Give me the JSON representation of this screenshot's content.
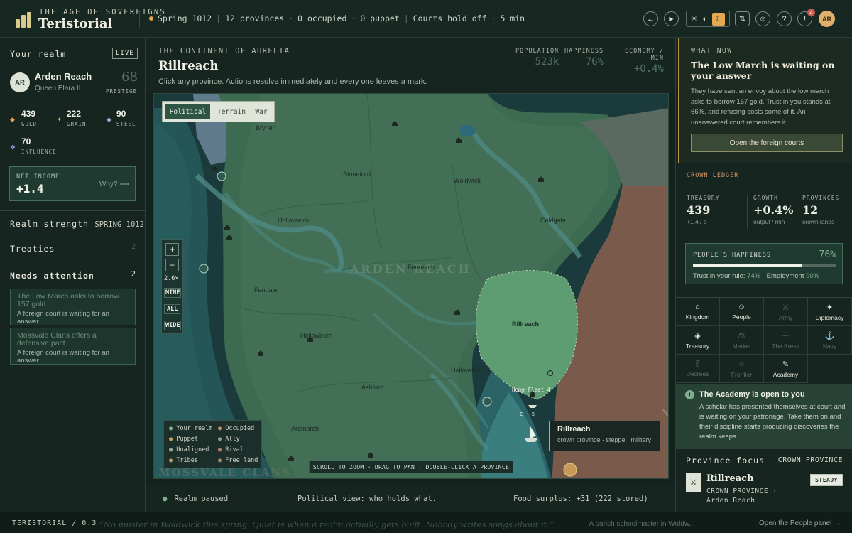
{
  "brand": {
    "subtitle": "THE AGE OF SOVEREIGNS",
    "name": "Teristorial"
  },
  "status": {
    "season": "Spring 1012",
    "provinces": "12 provinces",
    "occupied": "0 occupied",
    "puppet": "0 puppet",
    "courts": "Courts hold off",
    "time": "5 min"
  },
  "topbar": {
    "back": "←",
    "play": "▶",
    "theme_icons": [
      "☀",
      "◐",
      "☾"
    ],
    "sort": "⇅",
    "smile": "☺",
    "help": "?",
    "alert": "!",
    "alert_count": "4",
    "avatar": "AR"
  },
  "realm": {
    "section_title": "Your realm",
    "live": "LIVE",
    "avatar": "AR",
    "name": "Arden Reach",
    "ruler": "Queen Elara II",
    "prestige_value": "68",
    "prestige_label": "PRESTIGE",
    "resources": [
      {
        "value": "439",
        "label": "GOLD",
        "icon": "◆",
        "color": "#e0a54b"
      },
      {
        "value": "222",
        "label": "GRAIN",
        "icon": "✦",
        "color": "#c6c06a"
      },
      {
        "value": "90",
        "label": "STEEL",
        "icon": "◆",
        "color": "#8db0c9"
      },
      {
        "value": "70",
        "label": "INFLUENCE",
        "icon": "❖",
        "color": "#8f9fe0"
      }
    ],
    "net_income_label": "NET INCOME",
    "net_income": "+1.4",
    "why": "Why? ⟶",
    "strength_label": "Realm strength",
    "strength_season": "SPRING 1012",
    "treaties_label": "Treaties",
    "treaties_count": "2",
    "attention_label": "Needs attention",
    "attention_count": "2",
    "attention": [
      {
        "title": "The Low March asks to borrow 157 gold",
        "sub": "A foreign court is waiting for an answer."
      },
      {
        "title": "Mossvale Clans offers a defensive pact",
        "sub": "A foreign court is waiting for an answer."
      }
    ]
  },
  "center": {
    "continent": "THE CONTINENT OF AURELIA",
    "province": "Rillreach",
    "instruction": "Click any province. Actions resolve immediately and every one leaves a mark.",
    "stats": [
      {
        "label": "POPULATION",
        "value": "523k"
      },
      {
        "label": "HAPPINESS",
        "value": "76%"
      },
      {
        "label": "ECONOMY / MIN",
        "value": "+0.4%"
      }
    ],
    "map_tabs": [
      "Political",
      "Terrain",
      "War"
    ],
    "zoom": {
      "plus": "+",
      "minus": "−",
      "level": "2.6×",
      "mine": "MINE",
      "all": "ALL",
      "wide": "WIDE"
    },
    "realm_label": "ARDEN REACH",
    "region_label": "MOSSVALE CLANS",
    "edge_letter": "N",
    "towns": [
      "Brynen",
      "Stoneford",
      "Woldwick",
      "Hollowwick",
      "Caldgate",
      "Fenreach",
      "Fendale",
      "Rillreach",
      "Hollowburn",
      "Hollowdale",
      "Ashfurn",
      "Ardmarch"
    ],
    "fleet": "Home Fleet 4",
    "fleet_small": "C···5",
    "legend": [
      {
        "label": "Your realm",
        "color": "#7fae8e"
      },
      {
        "label": "Occupied",
        "color": "#c4876a"
      },
      {
        "label": "Puppet",
        "color": "#c6a25c"
      },
      {
        "label": "Ally",
        "color": "#8aa08a"
      },
      {
        "label": "Unaligned",
        "color": "#9aa89e"
      },
      {
        "label": "Rival",
        "color": "#b07a6a"
      },
      {
        "label": "Tribes",
        "color": "#b79a6a"
      },
      {
        "label": "Free land",
        "color": "#9c8a70"
      }
    ],
    "hint": "SCROLL TO ZOOM · DRAG TO PAN · DOUBLE-CLICK A PROVINCE",
    "tooltip_title": "Rillreach",
    "tooltip_sub": "crown province · steppe · military",
    "bottom": {
      "paused": "Realm paused",
      "view": "Political view: who holds what.",
      "food": "Food surplus: +31 (222 stored)"
    }
  },
  "right": {
    "what_now_label": "WHAT NOW",
    "what_now_title": "The Low March is waiting on your answer",
    "what_now_body": "They have sent an envoy about the low march asks to borrow 157 gold. Trust in you stands at 66%, and refusing costs some of it. An unanswered court remembers it.",
    "foreign_btn": "Open the foreign courts",
    "ledger_label": "CROWN LEDGER",
    "ledger": [
      {
        "label": "TREASURY",
        "value": "439",
        "sub": "+1.4 / s"
      },
      {
        "label": "GROWTH",
        "value": "+0.4%",
        "sub": "output / min"
      },
      {
        "label": "PROVINCES",
        "value": "12",
        "sub": "crown lands"
      }
    ],
    "happiness_label": "PEOPLE'S HAPPINESS",
    "happiness_value": "76%",
    "happiness_fraction": 0.76,
    "trust_text": "Trust in your rule:",
    "trust_value": "74%",
    "employment_text": "· Employment",
    "employment_value": "90%",
    "tabs": [
      {
        "label": "Kingdom",
        "icon": "⌂",
        "lit": true
      },
      {
        "label": "People",
        "icon": "☺",
        "lit": true
      },
      {
        "label": "Army",
        "icon": "⚔",
        "lit": false
      },
      {
        "label": "Diplomacy",
        "icon": "✦",
        "lit": true
      },
      {
        "label": "Treasury",
        "icon": "◈",
        "lit": true
      },
      {
        "label": "Market",
        "icon": "⚖",
        "lit": false
      },
      {
        "label": "The Press",
        "icon": "☰",
        "lit": false
      },
      {
        "label": "Navy",
        "icon": "⚓",
        "lit": false
      },
      {
        "label": "Decrees",
        "icon": "§",
        "lit": false
      },
      {
        "label": "Frontier",
        "icon": "✧",
        "lit": false
      },
      {
        "label": "Academy",
        "icon": "✎",
        "lit": true
      }
    ],
    "academy_title": "The Academy is open to you",
    "academy_body": "A scholar has presented themselves at court and is waiting on your patronage. Take them on and their discipline starts producing discoveries the realm keeps.",
    "focus_label": "Province focus",
    "focus_type": "CROWN PROVINCE",
    "focus_name": "Rillreach",
    "focus_sub": "CROWN PROVINCE · Arden Reach",
    "focus_badge": "STEADY"
  },
  "footer": {
    "version": "TERISTORIAL / 0.3",
    "quote": "“No muster in Woldwick this spring. Quiet is when a realm actually gets built. Nobody writes songs about it.”",
    "attribution": "· A parish schoolmaster in Woldw...",
    "link": "Open the People panel →"
  }
}
